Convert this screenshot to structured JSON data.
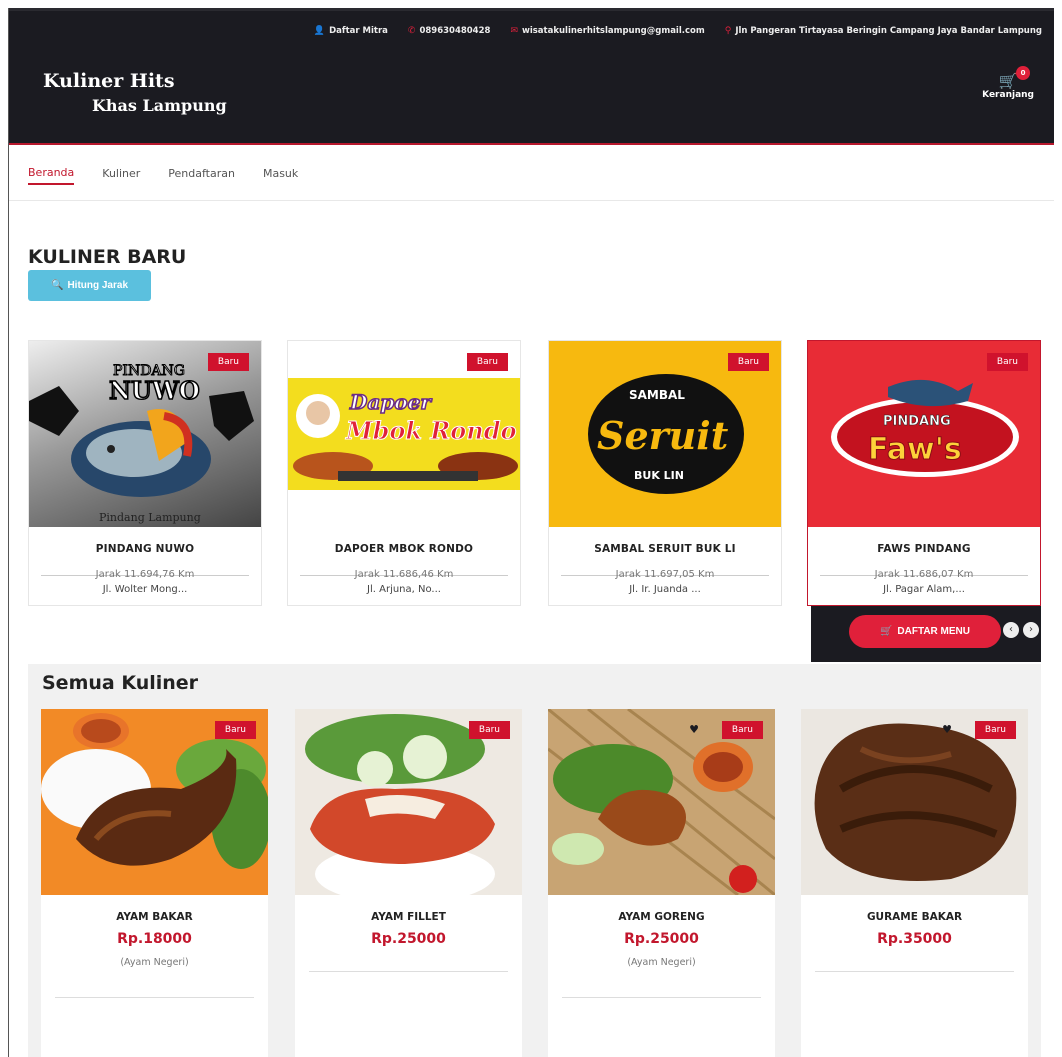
{
  "topbar": {
    "mitra": "Daftar Mitra",
    "phone": "089630480428",
    "email": "wisatakulinerhitslampung@gmail.com",
    "address": "Jln Pangeran Tirtayasa Beringin Campang Jaya Bandar Lampung"
  },
  "header": {
    "logo_line1": "Kuliner Hits",
    "logo_line2": "Khas Lampung",
    "cart_label": "Keranjang",
    "cart_count": "0"
  },
  "nav": [
    "Beranda",
    "Kuliner",
    "Pendaftaran",
    "Masuk"
  ],
  "kuliner_baru": {
    "title": "KULINER BARU",
    "button": "Hitung Jarak",
    "badge": "Baru",
    "items": [
      {
        "name": "PINDANG NUWO",
        "distance": "Jarak 11.694,76 Km",
        "address": "Jl. Wolter Mong...",
        "logo1": "PINDANG",
        "logo2": "NUWO",
        "logo3": "Pindang Lampung"
      },
      {
        "name": "DAPOER MBOK RONDO",
        "distance": "Jarak 11.686,46 Km",
        "address": "Jl. Arjuna, No...",
        "logo1": "Dapoer",
        "logo2": "Mbok Rondo"
      },
      {
        "name": "SAMBAL SERUIT BUK LI",
        "distance": "Jarak 11.697,05 Km",
        "address": "Jl. Ir. Juanda ...",
        "logo1": "SAMBAL",
        "logo2": "Seruit",
        "logo3": "BUK LIN"
      },
      {
        "name": "FAWS PINDANG",
        "distance": "Jarak 11.686,07 Km",
        "address": "Jl. Pagar Alam,...",
        "logo1": "PINDANG",
        "logo2": "Faw's"
      }
    ],
    "menu_button": "DAFTAR MENU"
  },
  "semua_kuliner": {
    "title": "Semua Kuliner",
    "badge": "Baru",
    "items": [
      {
        "name": "AYAM BAKAR",
        "price": "Rp.18000",
        "category": "(Ayam Negeri)"
      },
      {
        "name": "AYAM FILLET",
        "price": "Rp.25000",
        "category": ""
      },
      {
        "name": "AYAM GORENG",
        "price": "Rp.25000",
        "category": "(Ayam Negeri)"
      },
      {
        "name": "GURAME BAKAR",
        "price": "Rp.35000",
        "category": ""
      }
    ]
  },
  "colors": {
    "accent": "#c2172d",
    "dark": "#1b1b21",
    "info": "#5bc0de"
  }
}
